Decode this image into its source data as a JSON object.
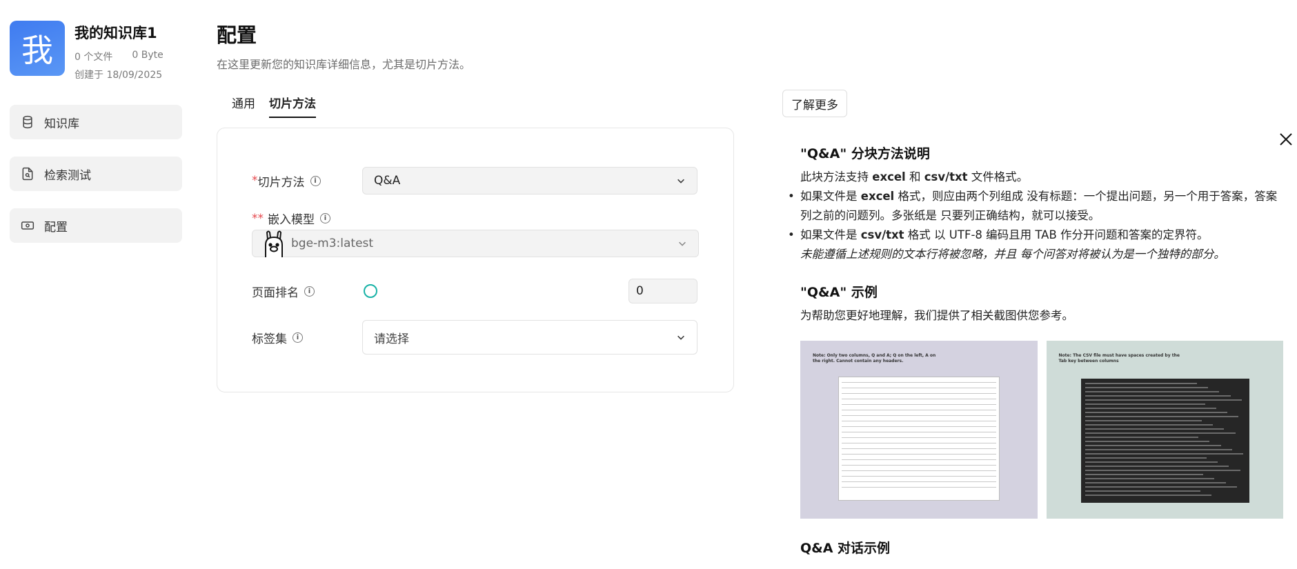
{
  "kb": {
    "avatar_char": "我",
    "name": "我的知识库1",
    "files": "0 个文件",
    "size": "0 Byte",
    "created": "创建于 18/09/2025"
  },
  "nav": {
    "items": [
      {
        "label": "知识库",
        "icon": "database-icon"
      },
      {
        "label": "检索测试",
        "icon": "file-search-icon"
      },
      {
        "label": "配置",
        "icon": "settings-card-icon"
      }
    ]
  },
  "header": {
    "title": "配置",
    "description": "在这里更新您的知识库详细信息，尤其是切片方法。"
  },
  "tabs": [
    {
      "label": "通用",
      "active": false
    },
    {
      "label": "切片方法",
      "active": true
    }
  ],
  "form": {
    "chunk_method": {
      "required_mark": "*",
      "label": "切片方法",
      "value": "Q&A"
    },
    "embedding_model": {
      "required_mark": "**",
      "label": "嵌入模型",
      "value": "bge-m3:latest"
    },
    "page_rank": {
      "label": "页面排名",
      "value": "0"
    },
    "tag_set": {
      "label": "标签集",
      "placeholder": "请选择"
    }
  },
  "right": {
    "learn_more": "了解更多",
    "qa_title": "\"Q&A\" 分块方法说明",
    "intro_pre": "此块方法支持 ",
    "intro_b1": "excel",
    "intro_mid": " 和 ",
    "intro_b2": "csv/txt",
    "intro_post": " 文件格式。",
    "bullet1_pre": "如果文件是 ",
    "bullet1_b": "excel",
    "bullet1_post": " 格式，则应由两个列组成 没有标题：一个提出问题，另一个用于答案，答案列之前的问题列。多张纸是 只要列正确结构，就可以接受。",
    "bullet2_pre": "如果文件是 ",
    "bullet2_b": "csv/txt",
    "bullet2_post": " 格式 以 UTF-8 编码且用 TAB 作分开问题和答案的定界符。",
    "note": "未能遵循上述规则的文本行将被忽略，并且 每个问答对将被认为是一个独特的部分。",
    "example_title": "\"Q&A\" 示例",
    "example_desc": "为帮助您更好地理解，我们提供了相关截图供您参考。",
    "img1_note": "Note: Only two columns, Q and A; Q on the left, A on the right. Cannot contain any headers.",
    "img2_note": "Note: The CSV file must have spaces created by the Tab key between columns",
    "dialog_title": "Q&A 对话示例"
  }
}
